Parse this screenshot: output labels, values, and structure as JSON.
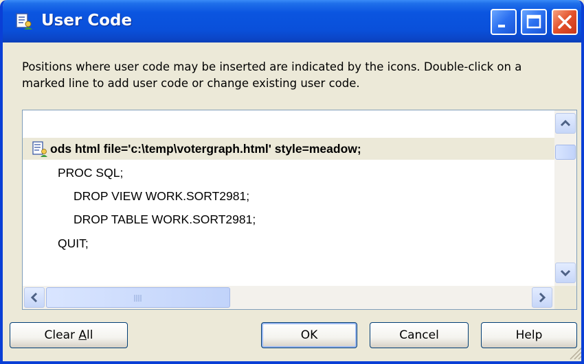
{
  "window": {
    "title": "User Code",
    "icon": "user-code-icon",
    "controls": [
      "minimize-icon",
      "maximize-icon",
      "close-icon"
    ]
  },
  "description": "Positions where user code may be inserted are indicated by the icons. Double-click on a marked line to add user code or change existing user code.",
  "code": {
    "lines": [
      {
        "text": "ods html file='c:\\temp\\votergraph.html' style=meadow;",
        "marked": true,
        "indent": 0
      },
      {
        "text": "PROC SQL;",
        "marked": false,
        "indent": 1
      },
      {
        "text": "DROP VIEW WORK.SORT2981;",
        "marked": false,
        "indent": 2
      },
      {
        "text": "DROP TABLE WORK.SORT2981;",
        "marked": false,
        "indent": 2
      },
      {
        "text": "QUIT;",
        "marked": false,
        "indent": 1
      }
    ],
    "highlight_color": "#ece9d8"
  },
  "buttons": {
    "clear_all_prefix": "Clear ",
    "clear_all_accel": "A",
    "clear_all_suffix": "ll",
    "ok": "OK",
    "cancel": "Cancel",
    "help": "Help"
  },
  "colors": {
    "titlebar": "#0a50da",
    "close": "#e2502a",
    "dialog_bg": "#ece9d8"
  }
}
